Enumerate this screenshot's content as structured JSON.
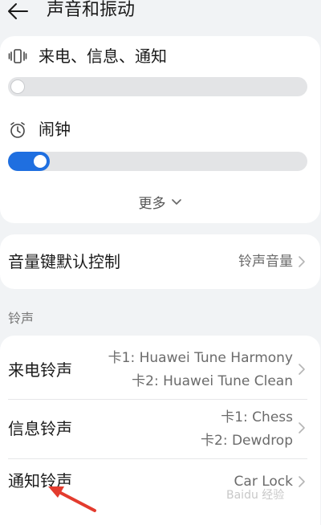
{
  "header": {
    "title": "声音和振动",
    "back_icon": "arrow-left-icon"
  },
  "volume_card": {
    "ring": {
      "label": "来电、信息、通知",
      "icon": "vibrate-phone-icon",
      "level": 0
    },
    "alarm": {
      "label": "闹钟",
      "icon": "alarm-clock-icon",
      "level": 0.08
    },
    "more_label": "更多"
  },
  "volume_key": {
    "label": "音量键默认控制",
    "value": "铃声音量"
  },
  "ringtone_section": {
    "title": "铃声",
    "items": [
      {
        "label": "来电铃声",
        "lines": [
          "卡1: Huawei Tune Harmony",
          "卡2: Huawei Tune Clean"
        ]
      },
      {
        "label": "信息铃声",
        "lines": [
          "卡1: Chess",
          "卡2: Dewdrop"
        ]
      },
      {
        "label": "通知铃声",
        "lines": [
          "Car Lock"
        ]
      }
    ]
  },
  "watermark": "Baidu 经验",
  "colors": {
    "accent": "#1f6fe0",
    "arrow": "#e33b2e"
  }
}
